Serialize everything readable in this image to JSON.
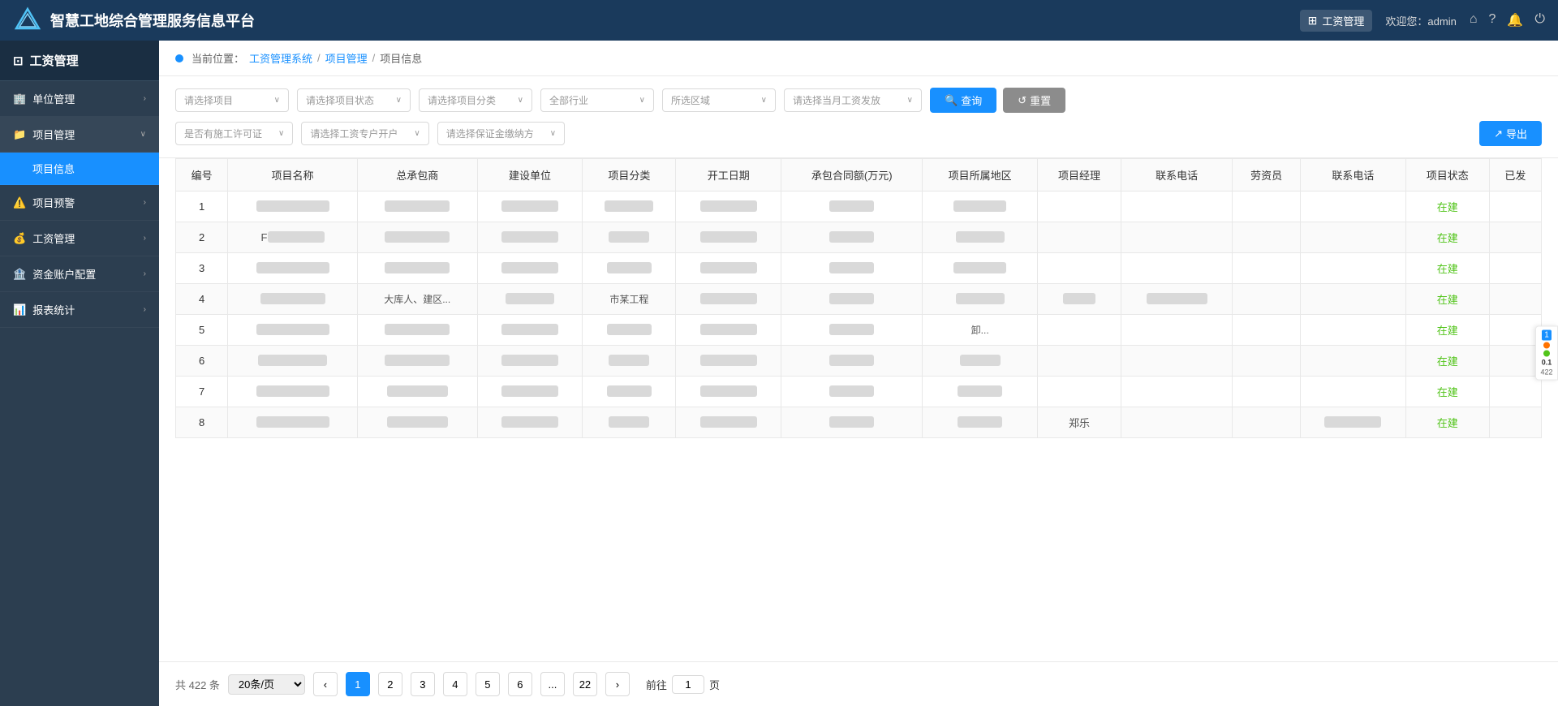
{
  "header": {
    "logo_text": "智慧工地综合管理服务信息平台",
    "module_label": "工资管理",
    "welcome_text": "欢迎您：admin",
    "icons": [
      "home",
      "help",
      "bell",
      "power"
    ]
  },
  "sidebar": {
    "title": "工资管理",
    "items": [
      {
        "id": "unit",
        "label": "单位管理",
        "icon": "🏢",
        "expanded": false,
        "active": false
      },
      {
        "id": "project",
        "label": "项目管理",
        "icon": "📁",
        "expanded": true,
        "active": false,
        "children": [
          {
            "id": "project-info",
            "label": "项目信息",
            "active": true
          }
        ]
      },
      {
        "id": "project-warning",
        "label": "项目预警",
        "icon": "⚠️",
        "expanded": false,
        "active": false
      },
      {
        "id": "salary",
        "label": "工资管理",
        "icon": "💰",
        "expanded": false,
        "active": false
      },
      {
        "id": "account",
        "label": "资金账户配置",
        "icon": "🏦",
        "expanded": false,
        "active": false
      },
      {
        "id": "report",
        "label": "报表统计",
        "icon": "📊",
        "expanded": false,
        "active": false
      }
    ]
  },
  "breadcrumb": {
    "system": "工资管理系统",
    "module": "项目管理",
    "page": "项目信息"
  },
  "filters": {
    "row1": [
      {
        "id": "project",
        "placeholder": "请选择项目"
      },
      {
        "id": "status",
        "placeholder": "请选择项目状态"
      },
      {
        "id": "category",
        "placeholder": "请选择项目分类"
      },
      {
        "id": "industry",
        "placeholder": "全部行业"
      },
      {
        "id": "region",
        "placeholder": "所选区域"
      },
      {
        "id": "salary_month",
        "placeholder": "请选择当月工资发放"
      }
    ],
    "row2": [
      {
        "id": "permit",
        "placeholder": "是否有施工许可证"
      },
      {
        "id": "account",
        "placeholder": "请选择工资专户开户"
      },
      {
        "id": "guarantee",
        "placeholder": "请选择保证金缴纳方"
      }
    ],
    "btn_query": "查询",
    "btn_reset": "重置",
    "btn_export": "导出"
  },
  "table": {
    "columns": [
      "编号",
      "项目名称",
      "总承包商",
      "建设单位",
      "项目分类",
      "开工日期",
      "承包合同额(万元)",
      "项目所属地区",
      "项目经理",
      "联系电话",
      "劳资员",
      "联系电话",
      "项目状态",
      "已发"
    ],
    "rows": [
      {
        "no": "1",
        "status": "在建"
      },
      {
        "no": "2",
        "col3": "F...",
        "status": "在建"
      },
      {
        "no": "3",
        "status": "在建"
      },
      {
        "no": "4",
        "col3": "大库人、建区...",
        "col5": "市某工程",
        "status": "在建"
      },
      {
        "no": "5",
        "col8": "卸...",
        "status": "在建"
      },
      {
        "no": "6",
        "status": "在建"
      },
      {
        "no": "7",
        "status": "在建"
      },
      {
        "no": "8",
        "col9": "郑乐",
        "status": "在建"
      }
    ]
  },
  "pagination": {
    "total_label": "共 422 条",
    "page_size": "20条/页",
    "pages": [
      "1",
      "2",
      "3",
      "4",
      "5",
      "6",
      "...",
      "22"
    ],
    "current": "1",
    "goto_label": "前往",
    "goto_value": "1",
    "page_unit": "页"
  },
  "float_panel": {
    "badge": "1",
    "count": "422"
  }
}
